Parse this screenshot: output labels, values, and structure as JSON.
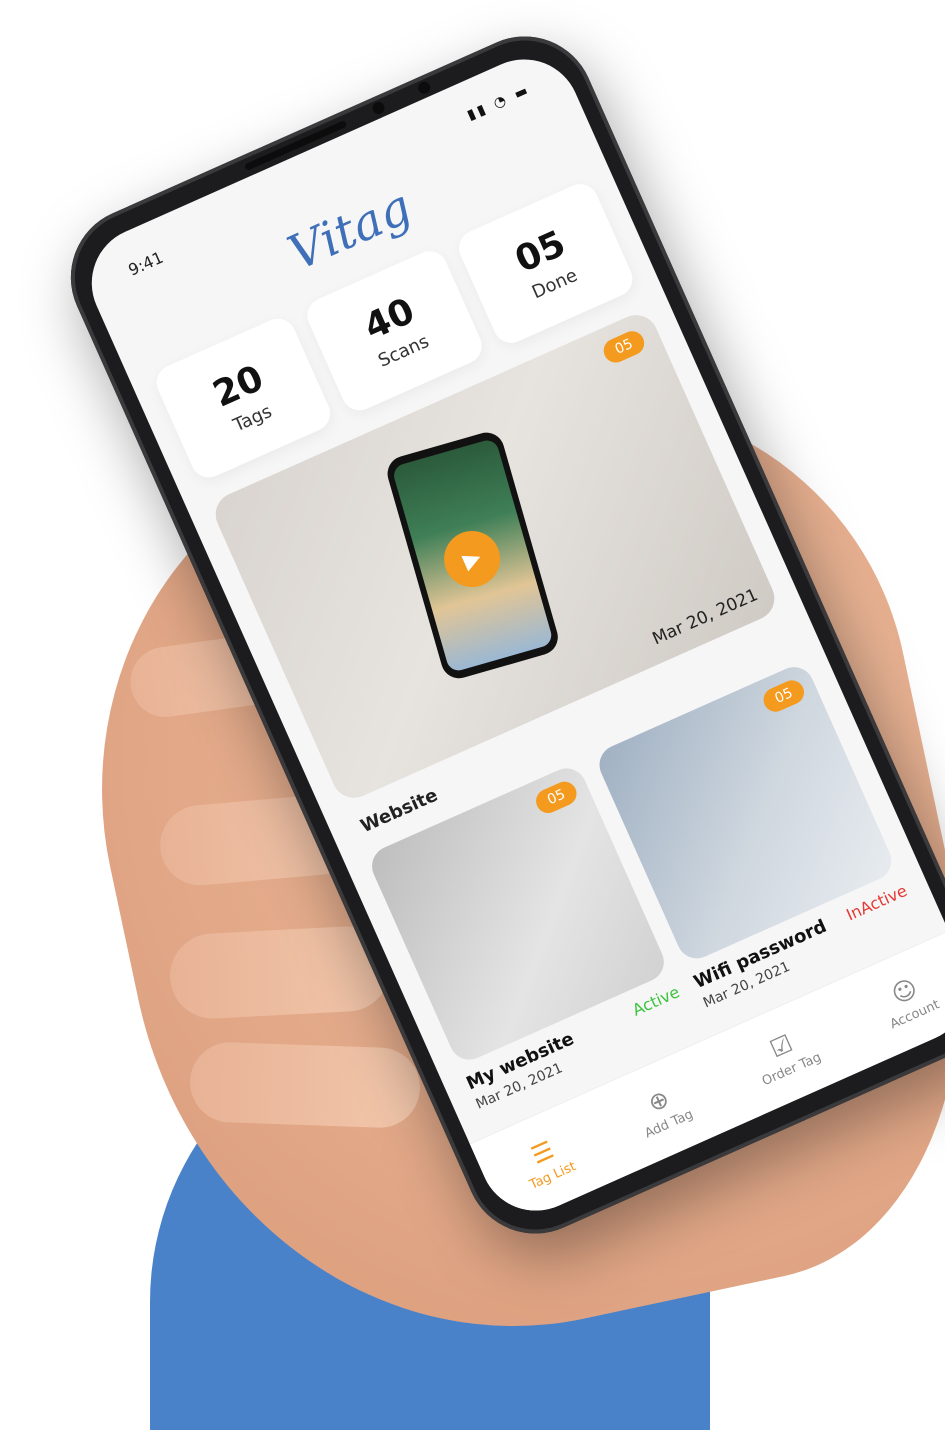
{
  "status": {
    "time": "9:41",
    "icons": "▮▮ ◔ ▬"
  },
  "app": {
    "title": "Vitag"
  },
  "stats": [
    {
      "value": "20",
      "label": "Tags"
    },
    {
      "value": "40",
      "label": "Scans"
    },
    {
      "value": "05",
      "label": "Done"
    }
  ],
  "feature": {
    "badge": "05",
    "date": "Mar 20, 2021",
    "section": "Website",
    "play_icon": "▶"
  },
  "cards": [
    {
      "badge": "05",
      "title": "My website",
      "status": "Active",
      "status_color": "#3cc43c",
      "date": "Mar 20, 2021"
    },
    {
      "badge": "05",
      "title": "Wifi password",
      "status": "InActive",
      "status_color": "#e53935",
      "date": "Mar 20, 2021"
    }
  ],
  "tabs": [
    {
      "label": "Tag List",
      "icon": "☰",
      "active": true
    },
    {
      "label": "Add Tag",
      "icon": "⊕"
    },
    {
      "label": "Order Tag",
      "icon": "☑"
    },
    {
      "label": "Account",
      "icon": "☺"
    }
  ],
  "colors": {
    "accent": "#f39a1f",
    "brand": "#3e6fb8",
    "backdrop": "#4a82c9"
  }
}
